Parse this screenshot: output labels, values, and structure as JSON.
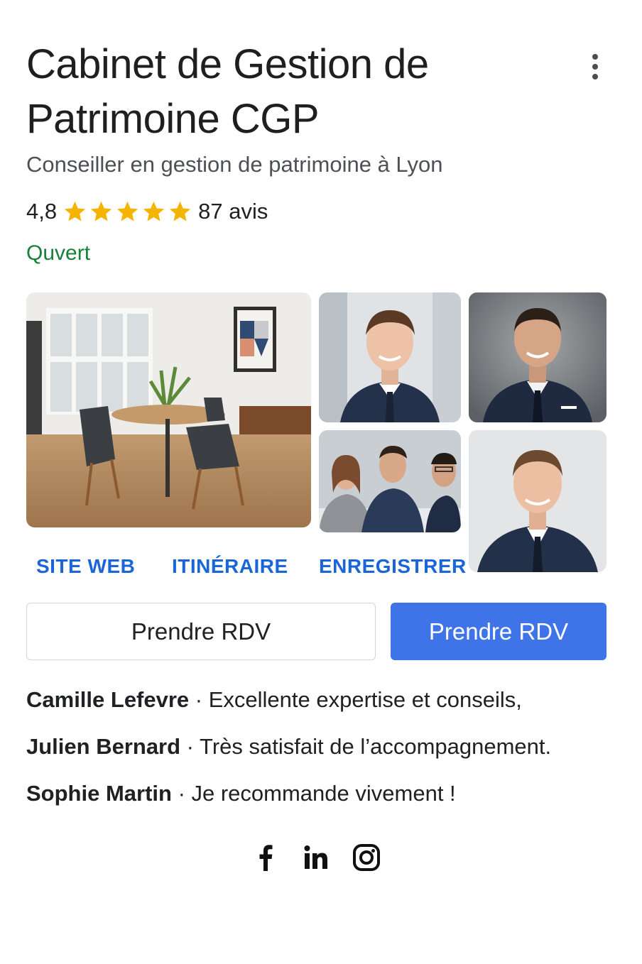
{
  "header": {
    "title": "Cabinet de Gestion de Patrimoine CGP",
    "subtitle": "Conseiller en gestion de patrimoine à Lyon"
  },
  "rating": {
    "score": "4,8",
    "stars": 5,
    "reviews_label": "87 avis",
    "star_color": "#f4b400"
  },
  "status": {
    "text": "Quvert",
    "color": "#188038"
  },
  "photos": [
    {
      "name": "office-dining-room"
    },
    {
      "name": "advisor-portrait-1"
    },
    {
      "name": "advisor-portrait-2"
    },
    {
      "name": "meeting-group"
    },
    {
      "name": "advisor-portrait-3"
    }
  ],
  "actions": {
    "website": "SITE WEB",
    "route": "ITINÉRAIRE",
    "save": "ENREGISTRER",
    "link_color": "#1a66d9"
  },
  "buttons": {
    "appointment_outline": "Prendre RDV",
    "appointment_primary": "Prendre RDV",
    "primary_color": "#3f74e8"
  },
  "reviews": [
    {
      "author": "Camille Lefevre",
      "text": " · Excellente expertise et conseils,"
    },
    {
      "author": "Julien Bernard",
      "text": " · Très satisfait de l’accompagnement."
    },
    {
      "author": "Sophie Martin",
      "text": " · Je recommande vivement !"
    }
  ],
  "social": [
    "facebook-icon",
    "linkedin-icon",
    "instagram-icon"
  ]
}
